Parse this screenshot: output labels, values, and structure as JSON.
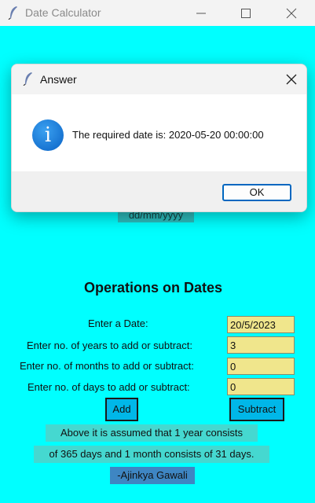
{
  "window": {
    "title": "Date Calculator",
    "icon": "feather-icon"
  },
  "form": {
    "hidden_hint": "dd/mm/yyyy",
    "heading": "Operations on Dates",
    "rows": [
      {
        "label": "Enter a Date:",
        "value": "20/5/2023"
      },
      {
        "label": "Enter no. of years to add or subtract:",
        "value": "3"
      },
      {
        "label": "Enter no. of months to add or subtract:",
        "value": "0"
      },
      {
        "label": "Enter no. of days to add or subtract:",
        "value": "0"
      }
    ],
    "add_label": "Add",
    "subtract_label": "Subtract",
    "note_line1": "Above it is assumed that 1 year consists",
    "note_line2": "of 365 days and 1 month consists of 31 days.",
    "author": "-Ajinkya Gawali"
  },
  "dialog": {
    "title": "Answer",
    "message": "The required date is: 2020-05-20 00:00:00",
    "ok_label": "OK",
    "icon": "info-icon"
  },
  "colors": {
    "background": "#00ffff",
    "entry": "#f0e68c",
    "button": "#00b7e8",
    "note": "#45d8d0",
    "author": "#3e86c3"
  }
}
